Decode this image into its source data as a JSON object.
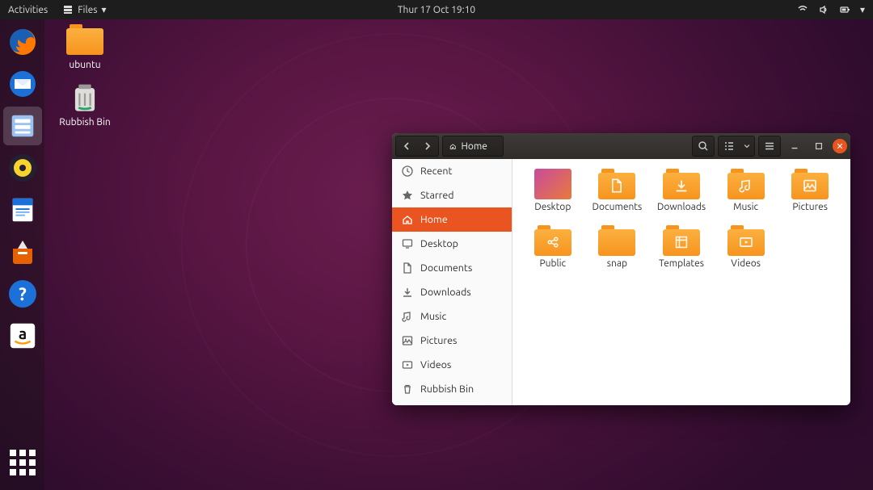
{
  "topbar": {
    "activities": "Activities",
    "app_label": "Files",
    "datetime": "Thur 17 Oct 19:10"
  },
  "desktop_icons": [
    {
      "name": "ubuntu",
      "type": "folder"
    },
    {
      "name": "Rubbish Bin",
      "type": "trash"
    }
  ],
  "window": {
    "path_label": "Home",
    "sidebar": [
      {
        "key": "recent",
        "label": "Recent",
        "icon": "clock"
      },
      {
        "key": "starred",
        "label": "Starred",
        "icon": "star"
      },
      {
        "key": "home",
        "label": "Home",
        "icon": "home",
        "selected": true
      },
      {
        "key": "desktop",
        "label": "Desktop",
        "icon": "desktop"
      },
      {
        "key": "documents",
        "label": "Documents",
        "icon": "document"
      },
      {
        "key": "downloads",
        "label": "Downloads",
        "icon": "download"
      },
      {
        "key": "music",
        "label": "Music",
        "icon": "music"
      },
      {
        "key": "pictures",
        "label": "Pictures",
        "icon": "picture"
      },
      {
        "key": "videos",
        "label": "Videos",
        "icon": "video"
      },
      {
        "key": "trash",
        "label": "Rubbish Bin",
        "icon": "trash"
      }
    ],
    "folders": [
      {
        "name": "Desktop",
        "icon": "desktop-gradient"
      },
      {
        "name": "Documents",
        "icon": "document"
      },
      {
        "name": "Downloads",
        "icon": "download"
      },
      {
        "name": "Music",
        "icon": "music"
      },
      {
        "name": "Pictures",
        "icon": "picture"
      },
      {
        "name": "Public",
        "icon": "share"
      },
      {
        "name": "snap",
        "icon": "none"
      },
      {
        "name": "Templates",
        "icon": "template"
      },
      {
        "name": "Videos",
        "icon": "video"
      }
    ]
  },
  "dock": [
    {
      "key": "firefox",
      "icon": "firefox"
    },
    {
      "key": "thunderbird",
      "icon": "thunderbird"
    },
    {
      "key": "files",
      "icon": "files",
      "active": true
    },
    {
      "key": "rhythmbox",
      "icon": "rhythmbox"
    },
    {
      "key": "writer",
      "icon": "writer"
    },
    {
      "key": "software",
      "icon": "software"
    },
    {
      "key": "help",
      "icon": "help"
    },
    {
      "key": "amazon",
      "icon": "amazon"
    }
  ]
}
